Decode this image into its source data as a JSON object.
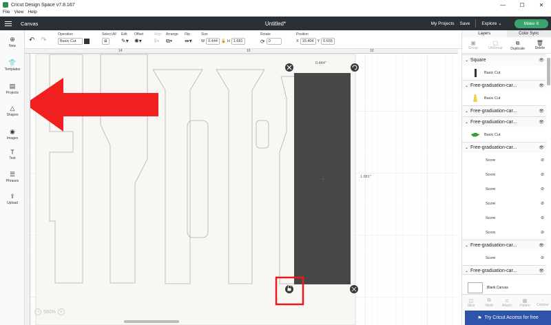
{
  "window": {
    "title": "Cricut Design Space  v7.8.167",
    "minimize": "—",
    "maximize": "☐",
    "close": "✕"
  },
  "menu": [
    "File",
    "View",
    "Help"
  ],
  "header": {
    "section": "Canvas",
    "doc_title": "Untitled*",
    "my_projects": "My Projects",
    "save": "Save",
    "explore": "Explore",
    "make": "Make It"
  },
  "toolbar": {
    "undo_icon": "↶",
    "redo_icon": "↷",
    "operation_label": "Operation",
    "operation_value": "Basic Cut",
    "select_all_label": "Select All",
    "edit_label": "Edit",
    "offset_label": "Offset",
    "align_label": "Align",
    "arrange_label": "Arrange",
    "flip_label": "Flip",
    "size_label": "Size",
    "w_label": "W",
    "w_value": "0.444",
    "h_label": "H",
    "h_value": "1.681",
    "rotate_label": "Rotate",
    "rotate_value": "0",
    "position_label": "Position",
    "x_label": "X",
    "x_value": "15.404",
    "y_label": "Y",
    "y_value": "0.655"
  },
  "sidebar": [
    {
      "label": "New",
      "icon": "⊕"
    },
    {
      "label": "Templates",
      "icon": "👕"
    },
    {
      "label": "Projects",
      "icon": "▤"
    },
    {
      "label": "Shapes",
      "icon": "△"
    },
    {
      "label": "Images",
      "icon": "◉"
    },
    {
      "label": "Text",
      "icon": "T"
    },
    {
      "label": "Phrases",
      "icon": "☰"
    },
    {
      "label": "Upload",
      "icon": "⇪"
    }
  ],
  "ruler": {
    "t1": "14",
    "t2": "15",
    "t3": "16"
  },
  "dimensions": {
    "width": "0.444\"",
    "height": "1.681\""
  },
  "zoom": {
    "level": "550%",
    "minus": "−",
    "plus": "+"
  },
  "panel": {
    "tabs": [
      "Layers",
      "Color Sync"
    ],
    "tools": [
      {
        "label": "Group",
        "icon": "▣",
        "enabled": false
      },
      {
        "label": "UnGroup",
        "icon": "▢",
        "enabled": false
      },
      {
        "label": "Duplicate",
        "icon": "⧉",
        "enabled": true
      },
      {
        "label": "Delete",
        "icon": "🗑",
        "enabled": true
      }
    ],
    "groups": [
      {
        "name": "Square",
        "rows": [
          {
            "label": "Basic Cut",
            "thumb": "#333333",
            "kind": "bar"
          }
        ]
      },
      {
        "name": "Free-graduation-car...",
        "rows": [
          {
            "label": "Basic Cut",
            "thumb": "#e8d44d",
            "kind": "tassel"
          }
        ]
      },
      {
        "name": "Free-graduation-car...",
        "rows": []
      },
      {
        "name": "Free-graduation-car...",
        "rows": [
          {
            "label": "Basic Cut",
            "thumb": "#3a9a3a",
            "kind": "cap"
          }
        ]
      },
      {
        "name": "Free-graduation-car...",
        "rows": [
          {
            "label": "Score",
            "kind": "score"
          },
          {
            "label": "Score",
            "kind": "score"
          },
          {
            "label": "Score",
            "kind": "score"
          },
          {
            "label": "Score",
            "kind": "score"
          },
          {
            "label": "Score",
            "kind": "score"
          },
          {
            "label": "Score",
            "kind": "score"
          }
        ]
      },
      {
        "name": "Free-graduation-car...",
        "rows": [
          {
            "label": "Score",
            "kind": "score"
          }
        ]
      },
      {
        "name": "Free-graduation-car...",
        "rows": []
      }
    ],
    "blank_canvas": "Blank Canvas",
    "bottom_tools": [
      "Slice",
      "Weld",
      "Attach",
      "Flatten",
      "Contour"
    ]
  },
  "access": {
    "label": "Try Cricut Access for free",
    "icon": "⚑"
  },
  "colors": {
    "accent": "#3aa36e",
    "header": "#2b3034",
    "arrow": "#f02020",
    "highlight": "#e8191d",
    "shape": "#474747"
  }
}
